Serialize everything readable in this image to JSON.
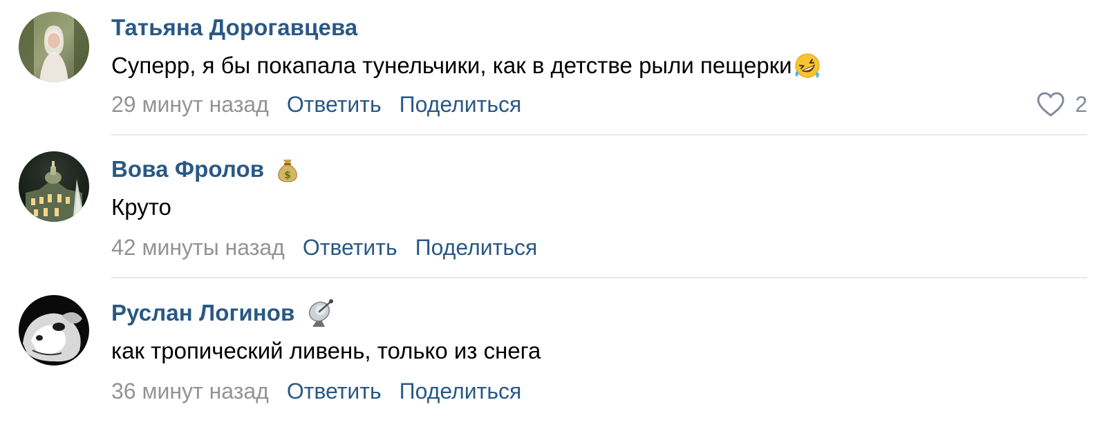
{
  "comments": [
    {
      "author": "Татьяна Дорогавцева",
      "avatar_icon": "avatar-woman-photo",
      "badge_icon": "",
      "text": "Суперр, я бы покапала тунельчики, как в детстве рыли пещерки",
      "text_emoji": "rolling-on-floor-laughing-emoji",
      "timestamp": "29 минут назад",
      "reply_label": "Ответить",
      "share_label": "Поделиться",
      "likes": "2"
    },
    {
      "author": "Вова Фролов",
      "avatar_icon": "avatar-night-building-photo",
      "badge_icon": "money-bag-icon",
      "text": "Круто",
      "timestamp": "42 минуты назад",
      "reply_label": "Ответить",
      "share_label": "Поделиться"
    },
    {
      "author": "Руслан Логинов",
      "avatar_icon": "avatar-dog-bw-photo",
      "badge_icon": "satellite-dish-icon",
      "text": "как тропический ливень, только из снега",
      "timestamp": "36 минут назад",
      "reply_label": "Ответить",
      "share_label": "Поделиться"
    }
  ],
  "colors": {
    "author_link": "#2a5885",
    "timestamp": "#939393",
    "text": "#000000",
    "divider": "#e7e8ec",
    "like_count": "#818c99"
  }
}
